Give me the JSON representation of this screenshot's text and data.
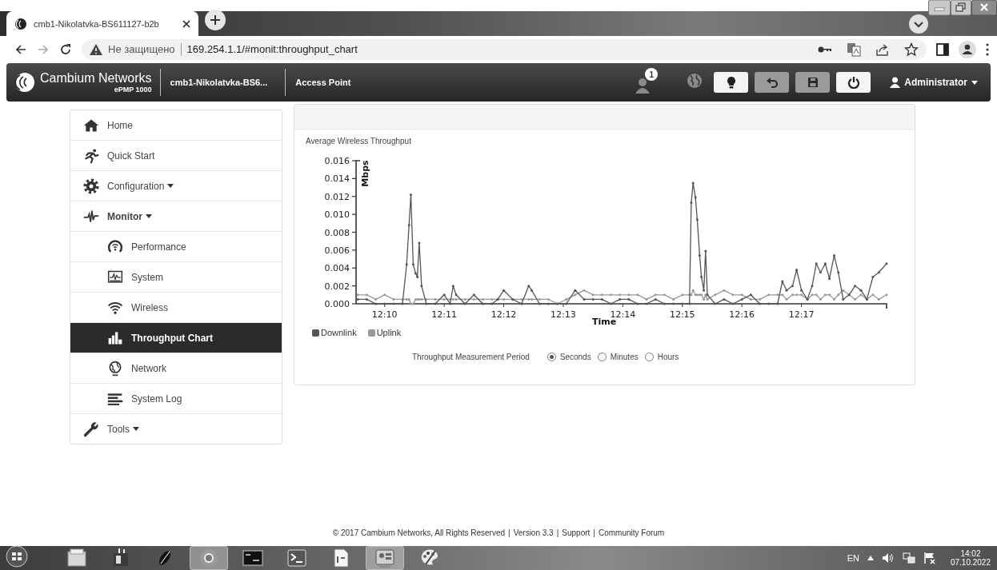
{
  "browser": {
    "tab_title": "cmb1-Nikolatvka-BS611127-b2b",
    "security_label": "Не защищено",
    "url": "169.254.1.1/#monit:throughput_chart"
  },
  "header": {
    "brand": "Cambium Networks",
    "model": "ePMP 1000",
    "device_name": "cmb1-Nikolatvka-BS6...",
    "mode": "Access Point",
    "notification_count": "1",
    "actions": [
      {
        "kind": "hint",
        "disabled": false
      },
      {
        "kind": "undo",
        "disabled": true
      },
      {
        "kind": "save",
        "disabled": true
      },
      {
        "kind": "power",
        "disabled": false
      }
    ],
    "user": "Administrator"
  },
  "sidebar": {
    "items": [
      {
        "label": "Home",
        "dropdown": false,
        "expanded": false,
        "selected": false
      },
      {
        "label": "Quick Start",
        "dropdown": false,
        "expanded": false,
        "selected": false
      },
      {
        "label": "Configuration",
        "dropdown": true,
        "expanded": false,
        "selected": false
      },
      {
        "label": "Monitor",
        "dropdown": true,
        "expanded": true,
        "selected": false,
        "children": [
          {
            "label": "Performance",
            "selected": false
          },
          {
            "label": "System",
            "selected": false
          },
          {
            "label": "Wireless",
            "selected": false
          },
          {
            "label": "Throughput Chart",
            "selected": true
          },
          {
            "label": "Network",
            "selected": false
          },
          {
            "label": "System Log",
            "selected": false
          }
        ]
      },
      {
        "label": "Tools",
        "dropdown": true,
        "expanded": false,
        "selected": false
      }
    ]
  },
  "panel": {
    "chart_data": {
      "type": "line",
      "title": "Average Wireless Throughput",
      "xlabel": "Time",
      "ylabel": "Mbps",
      "xlim": [
        729.52,
        738.43
      ],
      "ylim": [
        0,
        0.016
      ],
      "xticks": [
        {
          "value": 730,
          "label": "12:10"
        },
        {
          "value": 731,
          "label": "12:11"
        },
        {
          "value": 732,
          "label": "12:12"
        },
        {
          "value": 733,
          "label": "12:13"
        },
        {
          "value": 734,
          "label": "12:14"
        },
        {
          "value": 735,
          "label": "12:15"
        },
        {
          "value": 736,
          "label": "12:16"
        },
        {
          "value": 737,
          "label": "12:17"
        }
      ],
      "yticks": [
        {
          "value": 0,
          "label": "0.000"
        },
        {
          "value": 0.002,
          "label": "0.002"
        },
        {
          "value": 0.004,
          "label": "0.004"
        },
        {
          "value": 0.006,
          "label": "0.006"
        },
        {
          "value": 0.008,
          "label": "0.008"
        },
        {
          "value": 0.01,
          "label": "0.010"
        },
        {
          "value": 0.012,
          "label": "0.012"
        },
        {
          "value": 0.014,
          "label": "0.014"
        },
        {
          "value": 0.016,
          "label": "0.016"
        }
      ],
      "x": [
        729.55,
        729.7,
        729.85,
        730.0,
        730.15,
        730.3,
        730.37,
        730.41,
        730.44,
        730.48,
        730.52,
        730.55,
        730.58,
        730.62,
        730.7,
        730.85,
        731.0,
        731.1,
        731.15,
        731.2,
        731.35,
        731.5,
        731.65,
        731.8,
        731.9,
        732.0,
        732.15,
        732.3,
        732.42,
        732.47,
        732.6,
        732.75,
        732.9,
        733.05,
        733.2,
        733.35,
        733.5,
        733.65,
        733.8,
        733.95,
        734.1,
        734.25,
        734.4,
        734.55,
        734.7,
        734.85,
        735.0,
        735.12,
        735.15,
        735.18,
        735.22,
        735.25,
        735.29,
        735.32,
        735.36,
        735.39,
        735.42,
        735.55,
        735.7,
        735.85,
        736.0,
        736.15,
        736.3,
        736.45,
        736.6,
        736.68,
        736.75,
        736.85,
        736.92,
        737.0,
        737.1,
        737.18,
        737.25,
        737.32,
        737.4,
        737.47,
        737.55,
        737.62,
        737.7,
        737.8,
        737.9,
        738.0,
        738.1,
        738.2,
        738.3,
        738.43
      ],
      "series": [
        {
          "name": "Downlink",
          "color": "#555555",
          "values": [
            0.0005,
            0.0005,
            0,
            0,
            0,
            0,
            0.0044,
            0.0088,
            0.0122,
            0.0044,
            0.0034,
            0.003,
            0.0068,
            0.002,
            0,
            0,
            0.001,
            0,
            0.002,
            0.001,
            0,
            0.001,
            0,
            0,
            0.0005,
            0.0015,
            0.0005,
            0,
            0.002,
            0.0015,
            0,
            0,
            0,
            0,
            0.0015,
            0.0005,
            0.0005,
            0.0005,
            0,
            0.0005,
            0.0005,
            0,
            0,
            0.0005,
            0,
            0,
            0,
            0,
            0.0113,
            0.0135,
            0.0119,
            0.0094,
            0.0054,
            0.003,
            0.0015,
            0.0059,
            0.001,
            0,
            0.0005,
            0,
            0.0005,
            0.001,
            0,
            0,
            0,
            0.0025,
            0.0015,
            0.002,
            0.0038,
            0.0015,
            0.0005,
            0.002,
            0.0045,
            0.0035,
            0.0045,
            0.0028,
            0.0054,
            0.0035,
            0.0005,
            0.001,
            0.002,
            0.0015,
            0.0005,
            0.003,
            0.0035,
            0.0045
          ]
        },
        {
          "name": "Uplink",
          "color": "#999999",
          "values": [
            0.001,
            0.001,
            0.0005,
            0.001,
            0.0005,
            0.0005,
            0.0005,
            0.0005,
            0,
            0,
            0.0005,
            0.0005,
            0.0005,
            0.0005,
            0.0005,
            0.0005,
            0.0005,
            0.0005,
            0.0005,
            0.0005,
            0.0005,
            0.0005,
            0.0005,
            0.0005,
            0.0005,
            0.0005,
            0.0005,
            0.0005,
            0.0005,
            0.0005,
            0.0005,
            0.0005,
            0,
            0.0005,
            0.001,
            0.0015,
            0.001,
            0.001,
            0.001,
            0.001,
            0.001,
            0.001,
            0.0005,
            0.001,
            0.001,
            0.0005,
            0.001,
            0.001,
            0.001,
            0.0015,
            0.001,
            0.001,
            0.001,
            0.001,
            0.0005,
            0.001,
            0.0005,
            0.001,
            0.0015,
            0.001,
            0.001,
            0.0005,
            0.0005,
            0.001,
            0.001,
            0.001,
            0.0005,
            0.001,
            0.001,
            0.001,
            0.0005,
            0.001,
            0.001,
            0.0005,
            0.001,
            0.001,
            0.0005,
            0.001,
            0.0015,
            0.001,
            0.0005,
            0.001,
            0.0005,
            0.001,
            0.0005,
            0.001
          ]
        }
      ]
    },
    "period": {
      "label": "Throughput Measurement Period",
      "options": [
        {
          "label": "Seconds",
          "selected": true
        },
        {
          "label": "Minutes",
          "selected": false
        },
        {
          "label": "Hours",
          "selected": false
        }
      ]
    }
  },
  "footer": {
    "items": [
      "© 2017 Cambium Networks, All Rights Reserved",
      "|",
      "Version 3.3",
      "|",
      "Support",
      "|",
      "Community Forum"
    ]
  },
  "taskbar": {
    "apps": [
      {
        "active": false
      },
      {
        "active": false
      },
      {
        "active": false
      },
      {
        "active": true
      },
      {
        "active": false
      },
      {
        "active": false
      },
      {
        "active": false
      },
      {
        "active": true
      },
      {
        "active": false
      }
    ],
    "language": "EN",
    "time": "14:02",
    "date": "07.10.2022"
  }
}
